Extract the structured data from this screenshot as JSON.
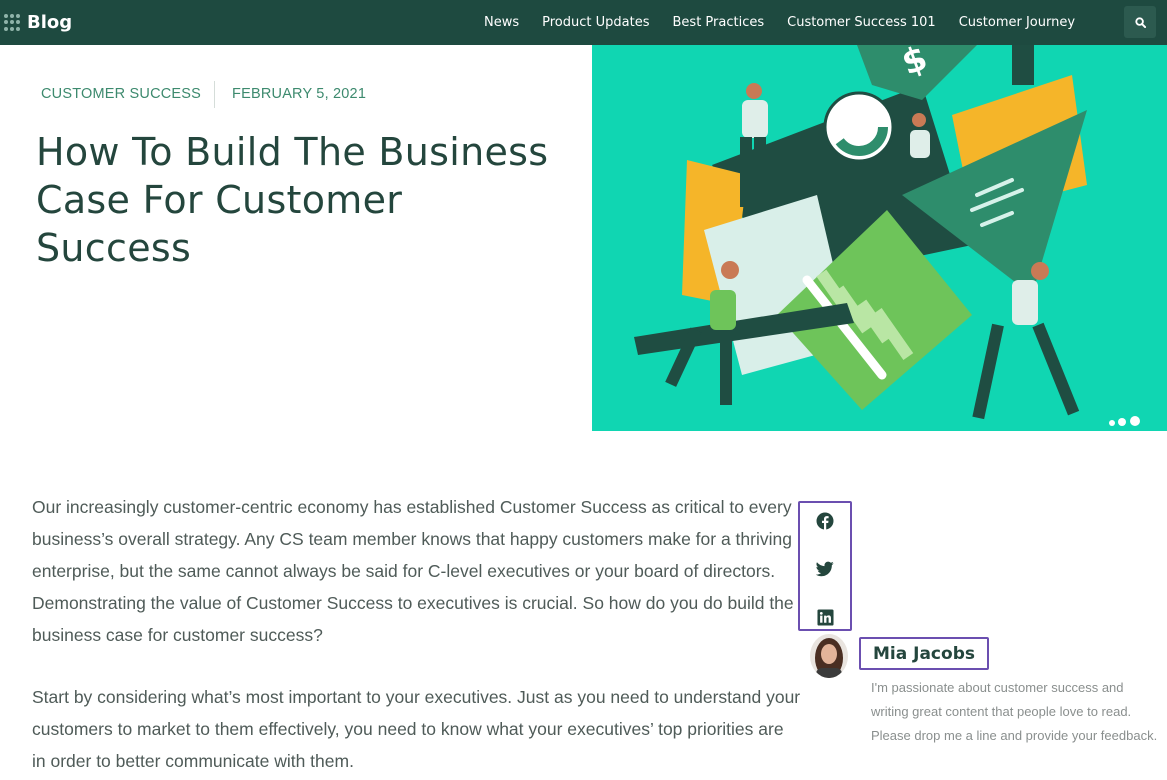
{
  "header": {
    "brand": "Blog",
    "nav": [
      "News",
      "Product Updates",
      "Best Practices",
      "Customer Success 101",
      "Customer Journey"
    ],
    "search_icon": "search-icon"
  },
  "post": {
    "category": "CUSTOMER SUCCESS",
    "date": "FEBRUARY 5, 2021",
    "title": "How To Build The Business Case For Customer Success",
    "paragraphs": [
      "Our increasingly customer-centric economy has established Customer Success as critical to every business’s overall strategy. Any CS team member knows that happy customers make for a thriving enterprise, but the same cannot always be said for C-level executives or your board of directors. Demonstrating the value of Customer Success to executives is crucial. So how do you do build the business case for customer success?",
      "Start by considering what’s most important to your executives. Just as you need to understand your customers to market to them effectively, you need to know what your executives’ top priorities are in order to better communicate with them."
    ]
  },
  "share": {
    "icons": [
      "facebook-icon",
      "twitter-icon",
      "linkedin-icon"
    ]
  },
  "author": {
    "name": "Mia Jacobs",
    "bio": "I'm passionate about customer success and writing great content that people love to read. Please drop me a line and provide your feedback."
  },
  "colors": {
    "header_bg": "#1e4a40",
    "title": "#24463d",
    "accent_green": "#3d8a6e",
    "hero_bg": "#10d6b2",
    "highlight_border": "#6b4fb0"
  }
}
